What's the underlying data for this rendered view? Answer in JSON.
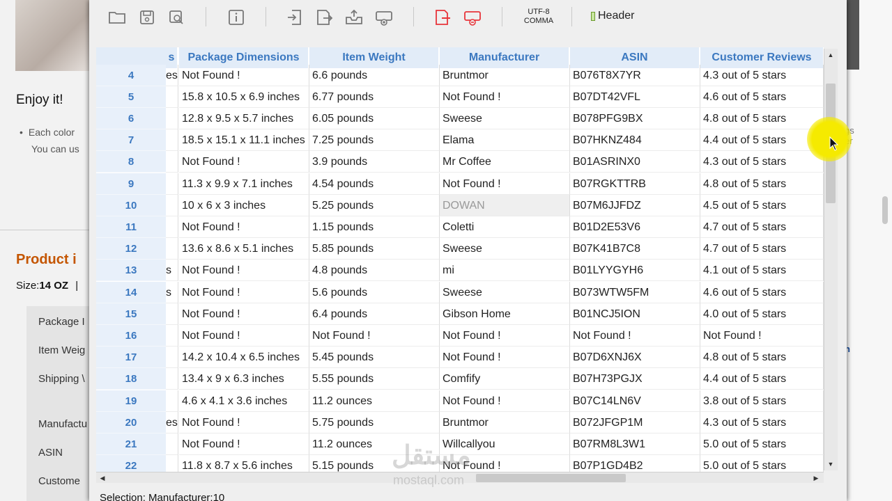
{
  "background_page": {
    "enjoy": "Enjoy it!",
    "bullet_line1": "Each color",
    "bullet_line2": "You can us",
    "product_heading": "Product i",
    "size_label": "Size:",
    "size_value": "14 OZ",
    "size_sep": "|",
    "rows": [
      "Package I",
      "Item Weig",
      "Shipping \\",
      "Manufactu",
      "ASIN",
      "Custome"
    ],
    "right_text1": "gs",
    "right_text1b": "er",
    "right_text2": "h"
  },
  "toolbar": {
    "encoding_line1": "UTF-8",
    "encoding_line2": "COMMA",
    "header_label": "Header",
    "icons": [
      "open-folder-icon",
      "save-icon",
      "save-as-icon",
      "info-icon",
      "import-icon",
      "export-icon",
      "upload-icon",
      "download-icon",
      "delete-column-icon",
      "delete-row-icon"
    ]
  },
  "grid": {
    "columns": [
      {
        "label": "s"
      },
      {
        "label": "Package Dimensions"
      },
      {
        "label": "Item Weight"
      },
      {
        "label": "Manufacturer"
      },
      {
        "label": "ASIN"
      },
      {
        "label": "Customer Reviews"
      }
    ],
    "rows": [
      {
        "num": "4",
        "c0": "es",
        "c1": "Not Found !",
        "c2": "6.6 pounds",
        "c3": "Bruntmor",
        "c4": "B076T8X7YR",
        "c5": "4.3 out of 5 stars"
      },
      {
        "num": "5",
        "c0": "",
        "c1": "15.8 x 10.5 x 6.9 inches",
        "c2": "6.77 pounds",
        "c3": "Not Found !",
        "c4": "B07DT42VFL",
        "c5": "4.6 out of 5 stars"
      },
      {
        "num": "6",
        "c0": "",
        "c1": "12.8 x 9.5 x 5.7 inches",
        "c2": "6.05 pounds",
        "c3": "Sweese",
        "c4": "B078PFG9BX",
        "c5": "4.8 out of 5 stars"
      },
      {
        "num": "7",
        "c0": "",
        "c1": "18.5 x 15.1 x 11.1 inches",
        "c2": "7.25 pounds",
        "c3": "Elama",
        "c4": "B07HKNZ484",
        "c5": "4.4 out of 5 stars"
      },
      {
        "num": "8",
        "c0": "",
        "c1": "Not Found !",
        "c2": "3.9 pounds",
        "c3": "Mr Coffee",
        "c4": "B01ASRINX0",
        "c5": "4.3 out of 5 stars"
      },
      {
        "num": "9",
        "c0": "",
        "c1": "11.3 x 9.9 x 7.1 inches",
        "c2": "4.54 pounds",
        "c3": "Not Found !",
        "c4": "B07RGKTTRB",
        "c5": "4.8 out of 5 stars"
      },
      {
        "num": "10",
        "c0": "",
        "c1": "10 x 6 x 3 inches",
        "c2": "5.25 pounds",
        "c3": "DOWAN",
        "c4": "B07M6JJFDZ",
        "c5": "4.5 out of 5 stars",
        "selected": true
      },
      {
        "num": "11",
        "c0": "",
        "c1": "Not Found !",
        "c2": "1.15 pounds",
        "c3": "Coletti",
        "c4": "B01D2E53V6",
        "c5": "4.7 out of 5 stars"
      },
      {
        "num": "12",
        "c0": "",
        "c1": "13.6 x 8.6 x 5.1 inches",
        "c2": "5.85 pounds",
        "c3": "Sweese",
        "c4": "B07K41B7C8",
        "c5": "4.7 out of 5 stars"
      },
      {
        "num": "13",
        "c0": "s",
        "c1": "Not Found !",
        "c2": "4.8 pounds",
        "c3": "mi",
        "c4": "B01LYYGYH6",
        "c5": "4.1 out of 5 stars"
      },
      {
        "num": "14",
        "c0": "s",
        "c1": "Not Found !",
        "c2": "5.6 pounds",
        "c3": "Sweese",
        "c4": "B073WTW5FM",
        "c5": "4.6 out of 5 stars"
      },
      {
        "num": "15",
        "c0": "",
        "c1": "Not Found !",
        "c2": "6.4 pounds",
        "c3": "Gibson Home",
        "c4": "B01NCJ5ION",
        "c5": "4.0 out of 5 stars"
      },
      {
        "num": "16",
        "c0": "",
        "c1": "Not Found !",
        "c2": "Not Found !",
        "c3": "Not Found !",
        "c4": "Not Found !",
        "c5": "Not Found !"
      },
      {
        "num": "17",
        "c0": "",
        "c1": "14.2 x 10.4 x 6.5 inches",
        "c2": "5.45 pounds",
        "c3": "Not Found !",
        "c4": "B07D6XNJ6X",
        "c5": "4.8 out of 5 stars"
      },
      {
        "num": "18",
        "c0": "",
        "c1": "13.4 x 9 x 6.3 inches",
        "c2": "5.55 pounds",
        "c3": "Comfify",
        "c4": "B07H73PGJX",
        "c5": "4.4 out of 5 stars"
      },
      {
        "num": "19",
        "c0": "",
        "c1": "4.6 x 4.1 x 3.6 inches",
        "c2": "11.2 ounces",
        "c3": "Not Found !",
        "c4": "B07C14LN6V",
        "c5": "3.8 out of 5 stars"
      },
      {
        "num": "20",
        "c0": "es",
        "c1": "Not Found !",
        "c2": "5.75 pounds",
        "c3": "Bruntmor",
        "c4": "B072JFGP1M",
        "c5": "4.3 out of 5 stars"
      },
      {
        "num": "21",
        "c0": "",
        "c1": "Not Found !",
        "c2": "11.2 ounces",
        "c3": "Willcallyou",
        "c4": "B07RM8L3W1",
        "c5": "5.0 out of 5 stars"
      },
      {
        "num": "22",
        "c0": "",
        "c1": "11.8 x 8.7 x 5.6 inches",
        "c2": "5.15 pounds",
        "c3": "Not Found !",
        "c4": "B07P1GD4B2",
        "c5": "5.0 out of 5 stars"
      }
    ]
  },
  "status": {
    "selection": "Selection: Manufacturer:10"
  },
  "watermark": {
    "main": "مستقل",
    "sub": "mostaql.com"
  },
  "colors": {
    "header_text": "#3b78c0",
    "header_bg": "#e2ecf8",
    "accent_red": "#e8343a",
    "cursor_highlight": "#f5ea00"
  }
}
